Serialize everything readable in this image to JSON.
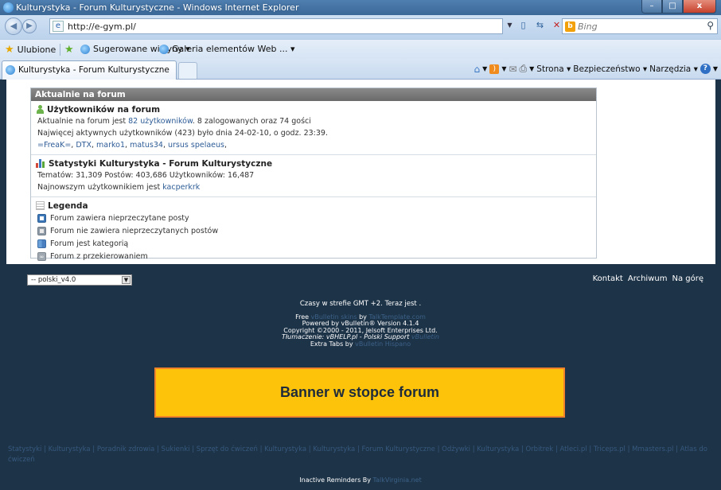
{
  "window": {
    "title": "Kulturystyka - Forum Kulturystyczne - Windows Internet Explorer",
    "min_label": "–",
    "max_label": "□",
    "close_label": "x"
  },
  "address_bar": {
    "url": "http://e-gym.pl/",
    "search_placeholder": "Bing"
  },
  "favorites_bar": {
    "favorites_label": "Ulubione",
    "suggested_label": "Sugerowane witryny ▾",
    "gallery_label": "Galeria elementów Web ... ▾"
  },
  "tab": {
    "label": "Kulturystyka - Forum Kulturystyczne"
  },
  "command_bar": {
    "page_label": "Strona ▾",
    "safety_label": "Bezpieczeństwo ▾",
    "tools_label": "Narzędzia ▾"
  },
  "forum_panel": {
    "header": "Aktualnie na forum",
    "users_section": {
      "title": "Użytkowników na forum",
      "line1_prefix": "Aktualnie na forum jest ",
      "line1_link": "82 użytkowników",
      "line1_suffix": ". 8 zalogowanych oraz 74 gości",
      "line2": "Najwięcej aktywnych użytkowników (423) było dnia 24-02-10, o godz. 23:39.",
      "online_users": [
        "=FreaK=",
        "DTX",
        "marko1",
        "matus34",
        "ursus spelaeus"
      ]
    },
    "stats_section": {
      "title": "Statystyki Kulturystyka - Forum Kulturystyczne",
      "line1": "Tematów: 31,309  Postów: 403,686  Użytkowników: 16,487",
      "line2_prefix": "Najnowszym użytkownikiem jest ",
      "line2_link": "kacperkrk"
    },
    "legend_section": {
      "title": "Legenda",
      "items": [
        "Forum zawiera nieprzeczytane posty",
        "Forum nie zawiera nieprzeczytanych postów",
        "Forum jest kategorią",
        "Forum z przekierowaniem"
      ]
    }
  },
  "footer_bar": {
    "language_value": "-- polski_v4.0",
    "links": [
      "Kontakt",
      "Archiwum",
      "Na górę"
    ]
  },
  "credits": {
    "timezone": "Czasy w strefie GMT +2. Teraz jest ",
    "free_label": "Free ",
    "free_link": "vBulletin skins",
    "by_label": " by ",
    "template_link": "TalkTemplate.com",
    "powered": "Powered by vBulletin® Version 4.1.4",
    "copyright": "Copyright ©2000 - 2011, Jelsoft Enterprises Ltd.",
    "translation": "Tłumaczenie: vBHELP.pl - Polski Support ",
    "translation_link": "vBulletin",
    "extra_tabs": "Extra Tabs by ",
    "extra_tabs_link": "vBulletin Hispano"
  },
  "banner": {
    "text": "Banner w stopce forum"
  },
  "seo_links": [
    "Statystyki",
    "Kulturystyka",
    "Poradnik zdrowia",
    "Sukienki",
    "Sprzęt do ćwiczeń",
    "Kulturystyka",
    "Kulturystyka",
    "Forum Kulturystyczne",
    "Odżywki",
    "Kulturystyka",
    "Orbitrek",
    "Atleci.pl",
    "Triceps.pl",
    "Mmasters.pl",
    "Atlas do ćwiczeń"
  ],
  "inactive": {
    "label": "Inactive Reminders By ",
    "link": "TalkVirginia.net"
  },
  "colors": {
    "footer_bg": "#1d3348",
    "banner_bg": "#fdc30b",
    "banner_border": "#f0822a",
    "link": "#2d5c96"
  }
}
